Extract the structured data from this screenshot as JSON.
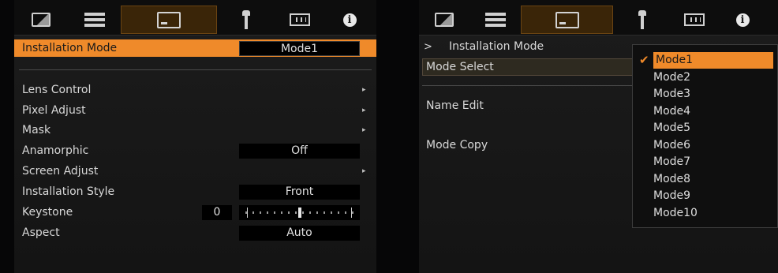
{
  "left": {
    "tabs": [
      {
        "icon": "picture-icon"
      },
      {
        "icon": "list-settings-icon"
      },
      {
        "icon": "screen-icon"
      },
      {
        "icon": "wrench-icon"
      },
      {
        "icon": "grid-icon"
      },
      {
        "icon": "info-icon"
      }
    ],
    "installation_mode": {
      "label": "Installation Mode",
      "value": "Mode1"
    },
    "menu": [
      {
        "label": "Lens Control",
        "arrow": true
      },
      {
        "label": "Pixel Adjust",
        "arrow": true
      },
      {
        "label": "Mask",
        "arrow": true
      },
      {
        "label": "Anamorphic",
        "value": "Off"
      },
      {
        "label": "Screen Adjust",
        "arrow": true
      },
      {
        "label": "Installation Style",
        "value": "Front"
      },
      {
        "label": "Keystone",
        "number": "0",
        "slider_fraction": 0.5
      },
      {
        "label": "Aspect",
        "value": "Auto"
      }
    ],
    "arrow_glyph": "▸"
  },
  "right": {
    "breadcrumb_prefix": ">",
    "breadcrumb": "Installation Mode",
    "items": [
      "Mode Select",
      "Name Edit",
      "Mode Copy"
    ],
    "check": "✔",
    "options": [
      "Mode1",
      "Mode2",
      "Mode3",
      "Mode4",
      "Mode5",
      "Mode6",
      "Mode7",
      "Mode8",
      "Mode9",
      "Mode10"
    ],
    "selected_option": "Mode1"
  },
  "colors": {
    "accent": "#ef8a2a",
    "active_tab": "#3a2508"
  }
}
